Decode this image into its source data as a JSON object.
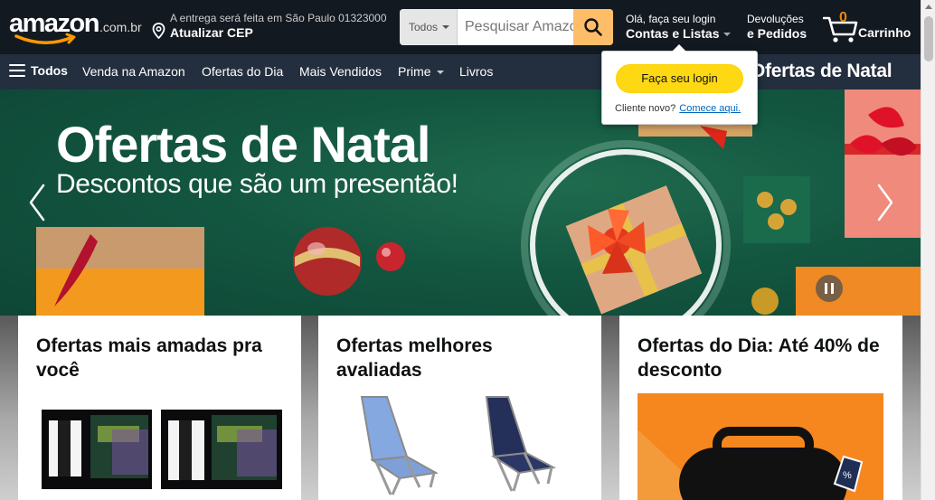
{
  "header": {
    "logo_text": "amazon",
    "logo_tld": ".com.br",
    "delivery_line1": "A entrega será feita em São Paulo 01323000",
    "delivery_line2": "Atualizar CEP",
    "search_category": "Todos",
    "search_placeholder": "Pesquisar Amazon.com.br",
    "account_line1": "Olá, faça seu login",
    "account_line2": "Contas e Listas",
    "returns_line1": "Devoluções",
    "returns_line2": "e Pedidos",
    "cart_count": "0",
    "cart_label": "Carrinho"
  },
  "subnav": {
    "all": "Todos",
    "items": [
      "Venda na Amazon",
      "Ofertas do Dia",
      "Mais Vendidos",
      "Prime",
      "Livros"
    ],
    "promo": "Ofertas de Natal"
  },
  "login_popover": {
    "button": "Faça seu login",
    "note": "Cliente novo?",
    "link": "Comece aqui."
  },
  "hero": {
    "title": "Ofertas de Natal",
    "subtitle": "Descontos que são um presentão!"
  },
  "cards": [
    {
      "title": "Ofertas mais amadas pra você"
    },
    {
      "title": "Ofertas melhores avaliadas"
    },
    {
      "title": "Ofertas do Dia: Até 40% de desconto"
    }
  ],
  "colors": {
    "nav_dark": "#131921",
    "nav_sub": "#232f3e",
    "search_button": "#febd69",
    "login_button": "#ffd814",
    "cart_count": "#f08804",
    "hero_green": "#135640"
  }
}
